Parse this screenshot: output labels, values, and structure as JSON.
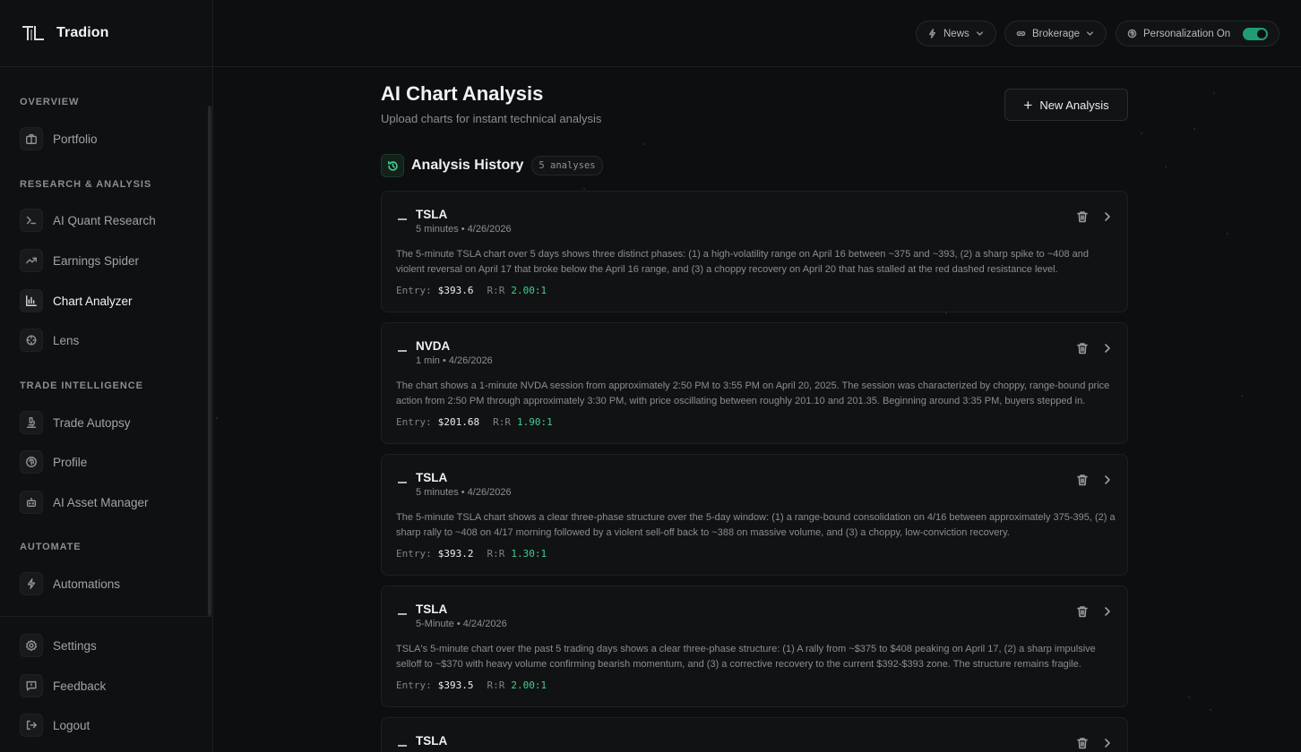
{
  "brand": {
    "name": "Tradion"
  },
  "topbar": {
    "news_label": "News",
    "brokerage_label": "Brokerage",
    "personalization_label": "Personalization On"
  },
  "sidebar": {
    "sections": [
      {
        "label": "Overview"
      },
      {
        "label": "Research & Analysis"
      },
      {
        "label": "Trade Intelligence"
      },
      {
        "label": "Automate"
      }
    ],
    "items": [
      {
        "label": "Portfolio",
        "icon": "briefcase-icon"
      },
      {
        "label": "AI Quant Research",
        "icon": "terminal-icon"
      },
      {
        "label": "Earnings Spider",
        "icon": "trending-up-icon"
      },
      {
        "label": "Chart Analyzer",
        "icon": "bar-chart-icon",
        "active": true
      },
      {
        "label": "Lens",
        "icon": "crosshair-icon"
      },
      {
        "label": "Trade Autopsy",
        "icon": "microscope-icon"
      },
      {
        "label": "Profile",
        "icon": "fingerprint-icon"
      },
      {
        "label": "AI Asset Manager",
        "icon": "bot-icon"
      },
      {
        "label": "Automations",
        "icon": "zap-icon"
      }
    ],
    "bottom_items": [
      {
        "label": "Settings",
        "icon": "gear-icon"
      },
      {
        "label": "Feedback",
        "icon": "message-icon"
      },
      {
        "label": "Logout",
        "icon": "logout-icon"
      }
    ]
  },
  "main": {
    "title": "AI Chart Analysis",
    "subtitle": "Upload charts for instant technical analysis",
    "new_button_label": "New Analysis",
    "history_title": "Analysis History",
    "history_count": "5 analyses",
    "entry_label": "Entry:",
    "rr_label": "R:R",
    "analyses": [
      {
        "symbol": "TSLA",
        "meta": "5 minutes • 4/26/2026",
        "description": "The 5-minute TSLA chart over 5 days shows three distinct phases: (1) a high-volatility range on April 16 between ~375 and ~393, (2) a sharp spike to ~408 and violent reversal on April 17 that broke below the April 16 range, and (3) a choppy recovery on April 20 that has stalled at the red dashed resistance level.",
        "entry": "$393.6",
        "rr": "2.00:1"
      },
      {
        "symbol": "NVDA",
        "meta": "1 min • 4/26/2026",
        "description": "The chart shows a 1-minute NVDA session from approximately 2:50 PM to 3:55 PM on April 20, 2025. The session was characterized by choppy, range-bound price action from 2:50 PM through approximately 3:30 PM, with price oscillating between roughly 201.10 and 201.35. Beginning around 3:35 PM, buyers stepped in.",
        "entry": "$201.68",
        "rr": "1.90:1"
      },
      {
        "symbol": "TSLA",
        "meta": "5 minutes • 4/26/2026",
        "description": "The 5-minute TSLA chart shows a clear three-phase structure over the 5-day window: (1) a range-bound consolidation on 4/16 between approximately 375-395, (2) a sharp rally to ~408 on 4/17 morning followed by a violent sell-off back to ~388 on massive volume, and (3) a choppy, low-conviction recovery.",
        "entry": "$393.2",
        "rr": "1.30:1"
      },
      {
        "symbol": "TSLA",
        "meta": "5-Minute • 4/24/2026",
        "description": "TSLA's 5-minute chart over the past 5 trading days shows a clear three-phase structure: (1) A rally from ~$375 to $408 peaking on April 17, (2) a sharp impulsive selloff to ~$370 with heavy volume confirming bearish momentum, and (3) a corrective recovery to the current $392-$393 zone. The structure remains fragile.",
        "entry": "$393.5",
        "rr": "2.00:1"
      },
      {
        "symbol": "TSLA",
        "meta": "",
        "description": "",
        "entry": "",
        "rr": ""
      }
    ]
  }
}
